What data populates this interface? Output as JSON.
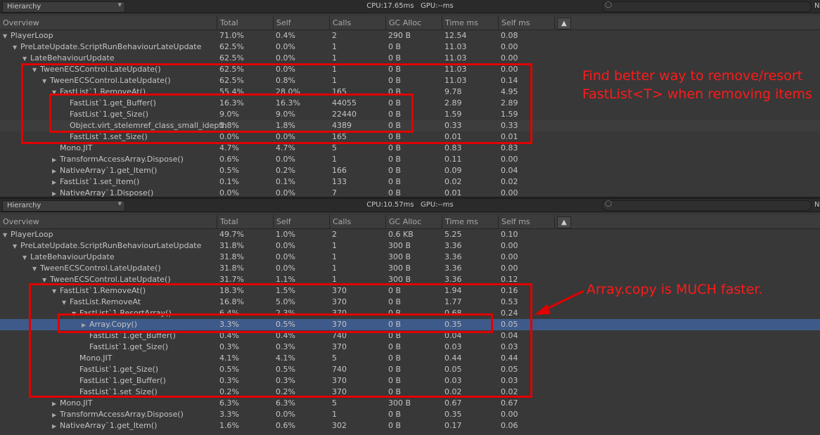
{
  "panels": [
    {
      "toolbar": {
        "view_mode": "Hierarchy",
        "cpu": "CPU:17.65ms",
        "gpu": "GPU:--ms",
        "edge_label": "N"
      },
      "columns": [
        "Overview",
        "Total",
        "Self",
        "Calls",
        "GC Alloc",
        "Time ms",
        "Self ms"
      ],
      "rows": [
        {
          "depth": 0,
          "exp": "down",
          "name": "PlayerLoop",
          "total": "71.0%",
          "self": "0.4%",
          "calls": "2",
          "gc": "290 B",
          "time": "12.54",
          "selfms": "0.08"
        },
        {
          "depth": 1,
          "exp": "down",
          "name": "PreLateUpdate.ScriptRunBehaviourLateUpdate",
          "total": "62.5%",
          "self": "0.0%",
          "calls": "1",
          "gc": "0 B",
          "time": "11.03",
          "selfms": "0.00"
        },
        {
          "depth": 2,
          "exp": "down",
          "name": "LateBehaviourUpdate",
          "total": "62.5%",
          "self": "0.0%",
          "calls": "1",
          "gc": "0 B",
          "time": "11.03",
          "selfms": "0.00"
        },
        {
          "depth": 3,
          "exp": "down",
          "name": "TweenECSControl.LateUpdate()",
          "total": "62.5%",
          "self": "0.0%",
          "calls": "1",
          "gc": "0 B",
          "time": "11.03",
          "selfms": "0.00"
        },
        {
          "depth": 4,
          "exp": "down",
          "name": "TweenECSControl.LateUpdate()",
          "total": "62.5%",
          "self": "0.8%",
          "calls": "1",
          "gc": "0 B",
          "time": "11.03",
          "selfms": "0.14"
        },
        {
          "depth": 5,
          "exp": "down",
          "name": "FastList`1.RemoveAt()",
          "total": "55.4%",
          "self": "28.0%",
          "calls": "165",
          "gc": "0 B",
          "time": "9.78",
          "selfms": "4.95"
        },
        {
          "depth": 6,
          "exp": "",
          "name": "FastList`1.get_Buffer()",
          "total": "16.3%",
          "self": "16.3%",
          "calls": "44055",
          "gc": "0 B",
          "time": "2.89",
          "selfms": "2.89"
        },
        {
          "depth": 6,
          "exp": "",
          "name": "FastList`1.get_Size()",
          "total": "9.0%",
          "self": "9.0%",
          "calls": "22440",
          "gc": "0 B",
          "time": "1.59",
          "selfms": "1.59"
        },
        {
          "depth": 6,
          "exp": "",
          "name": "Object.virt_stelemref_class_small_idepth",
          "total": "1.8%",
          "self": "1.8%",
          "calls": "4389",
          "gc": "0 B",
          "time": "0.33",
          "selfms": "0.33",
          "alt": true
        },
        {
          "depth": 6,
          "exp": "",
          "name": "FastList`1.set_Size()",
          "total": "0.0%",
          "self": "0.0%",
          "calls": "165",
          "gc": "0 B",
          "time": "0.01",
          "selfms": "0.01"
        },
        {
          "depth": 5,
          "exp": "",
          "name": "Mono.JIT",
          "total": "4.7%",
          "self": "4.7%",
          "calls": "5",
          "gc": "0 B",
          "time": "0.83",
          "selfms": "0.83"
        },
        {
          "depth": 5,
          "exp": "right",
          "name": "TransformAccessArray.Dispose()",
          "total": "0.6%",
          "self": "0.0%",
          "calls": "1",
          "gc": "0 B",
          "time": "0.11",
          "selfms": "0.00"
        },
        {
          "depth": 5,
          "exp": "right",
          "name": "NativeArray`1.get_Item()",
          "total": "0.5%",
          "self": "0.2%",
          "calls": "166",
          "gc": "0 B",
          "time": "0.09",
          "selfms": "0.04"
        },
        {
          "depth": 5,
          "exp": "right",
          "name": "FastList`1.set_Item()",
          "total": "0.1%",
          "self": "0.1%",
          "calls": "133",
          "gc": "0 B",
          "time": "0.02",
          "selfms": "0.02"
        },
        {
          "depth": 5,
          "exp": "right",
          "name": "NativeArray`1.Dispose()",
          "total": "0.0%",
          "self": "0.0%",
          "calls": "7",
          "gc": "0 B",
          "time": "0.01",
          "selfms": "0.00"
        }
      ]
    },
    {
      "toolbar": {
        "view_mode": "Hierarchy",
        "cpu": "CPU:10.57ms",
        "gpu": "GPU:--ms",
        "edge_label": "N"
      },
      "columns": [
        "Overview",
        "Total",
        "Self",
        "Calls",
        "GC Alloc",
        "Time ms",
        "Self ms"
      ],
      "rows": [
        {
          "depth": 0,
          "exp": "down",
          "name": "PlayerLoop",
          "total": "49.7%",
          "self": "1.0%",
          "calls": "2",
          "gc": "0.6 KB",
          "time": "5.25",
          "selfms": "0.10"
        },
        {
          "depth": 1,
          "exp": "down",
          "name": "PreLateUpdate.ScriptRunBehaviourLateUpdate",
          "total": "31.8%",
          "self": "0.0%",
          "calls": "1",
          "gc": "300 B",
          "time": "3.36",
          "selfms": "0.00"
        },
        {
          "depth": 2,
          "exp": "down",
          "name": "LateBehaviourUpdate",
          "total": "31.8%",
          "self": "0.0%",
          "calls": "1",
          "gc": "300 B",
          "time": "3.36",
          "selfms": "0.00"
        },
        {
          "depth": 3,
          "exp": "down",
          "name": "TweenECSControl.LateUpdate()",
          "total": "31.8%",
          "self": "0.0%",
          "calls": "1",
          "gc": "300 B",
          "time": "3.36",
          "selfms": "0.00"
        },
        {
          "depth": 4,
          "exp": "down",
          "name": "TweenECSControl.LateUpdate()",
          "total": "31.7%",
          "self": "1.1%",
          "calls": "1",
          "gc": "300 B",
          "time": "3.36",
          "selfms": "0.12"
        },
        {
          "depth": 5,
          "exp": "down",
          "name": "FastList`1.RemoveAt()",
          "total": "18.3%",
          "self": "1.5%",
          "calls": "370",
          "gc": "0 B",
          "time": "1.94",
          "selfms": "0.16"
        },
        {
          "depth": 6,
          "exp": "down",
          "name": "FastList.RemoveAt",
          "total": "16.8%",
          "self": "5.0%",
          "calls": "370",
          "gc": "0 B",
          "time": "1.77",
          "selfms": "0.53"
        },
        {
          "depth": 7,
          "exp": "down",
          "name": "FastList`1.ResortArray()",
          "total": "6.4%",
          "self": "2.3%",
          "calls": "370",
          "gc": "0 B",
          "time": "0.68",
          "selfms": "0.24"
        },
        {
          "depth": 8,
          "exp": "right",
          "name": "Array.Copy()",
          "total": "3.3%",
          "self": "0.5%",
          "calls": "370",
          "gc": "0 B",
          "time": "0.35",
          "selfms": "0.05",
          "sel": true
        },
        {
          "depth": 8,
          "exp": "",
          "name": "FastList`1.get_Buffer()",
          "total": "0.4%",
          "self": "0.4%",
          "calls": "740",
          "gc": "0 B",
          "time": "0.04",
          "selfms": "0.04"
        },
        {
          "depth": 8,
          "exp": "",
          "name": "FastList`1.get_Size()",
          "total": "0.3%",
          "self": "0.3%",
          "calls": "370",
          "gc": "0 B",
          "time": "0.03",
          "selfms": "0.03"
        },
        {
          "depth": 7,
          "exp": "",
          "name": "Mono.JIT",
          "total": "4.1%",
          "self": "4.1%",
          "calls": "5",
          "gc": "0 B",
          "time": "0.44",
          "selfms": "0.44"
        },
        {
          "depth": 7,
          "exp": "",
          "name": "FastList`1.get_Size()",
          "total": "0.5%",
          "self": "0.5%",
          "calls": "740",
          "gc": "0 B",
          "time": "0.05",
          "selfms": "0.05"
        },
        {
          "depth": 7,
          "exp": "",
          "name": "FastList`1.get_Buffer()",
          "total": "0.3%",
          "self": "0.3%",
          "calls": "370",
          "gc": "0 B",
          "time": "0.03",
          "selfms": "0.03"
        },
        {
          "depth": 7,
          "exp": "",
          "name": "FastList`1.set_Size()",
          "total": "0.2%",
          "self": "0.2%",
          "calls": "370",
          "gc": "0 B",
          "time": "0.02",
          "selfms": "0.02"
        },
        {
          "depth": 5,
          "exp": "right",
          "name": "Mono.JIT",
          "total": "6.3%",
          "self": "6.3%",
          "calls": "5",
          "gc": "300 B",
          "time": "0.67",
          "selfms": "0.67"
        },
        {
          "depth": 5,
          "exp": "right",
          "name": "TransformAccessArray.Dispose()",
          "total": "3.3%",
          "self": "0.0%",
          "calls": "1",
          "gc": "0 B",
          "time": "0.35",
          "selfms": "0.00"
        },
        {
          "depth": 5,
          "exp": "right",
          "name": "NativeArray`1.get_Item()",
          "total": "1.6%",
          "self": "0.6%",
          "calls": "302",
          "gc": "0 B",
          "time": "0.17",
          "selfms": "0.06"
        }
      ]
    }
  ],
  "annotations": {
    "top_note": [
      "Find better way to remove/resort",
      "FastList<T> when removing items"
    ],
    "bottom_note": "Array.copy is MUCH faster.",
    "color": "#ff1a1a"
  },
  "colors": {
    "background": "#383838",
    "selected_row": "#3e5a8a",
    "highlight": "#e00000"
  }
}
